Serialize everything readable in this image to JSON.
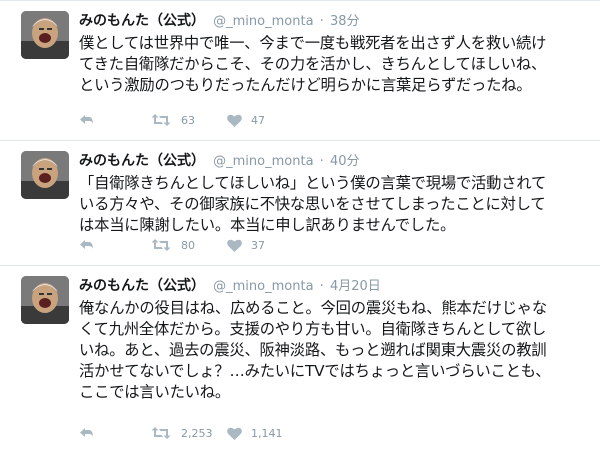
{
  "tweets": [
    {
      "name": "みのもんた（公式）",
      "handle": "@_mino_monta",
      "separator": "·",
      "time": "38分",
      "text": "僕としては世界中で唯一、今まで一度も戦死者を出さず人を救い続け\nてきた自衛隊だからこそ、その力を活かし、きちんとしてほしいね、\nという激励のつもりだったんだけど明らかに言葉足らずだったね。",
      "retweets": "63",
      "likes": "47"
    },
    {
      "name": "みのもんた（公式）",
      "handle": "@_mino_monta",
      "separator": "·",
      "time": "40分",
      "text": "「自衛隊きちんとしてほしいね」という僕の言葉で現場で活動されて\nいる方々や、その御家族に不快な思いをさせてしまったことに対して\nは本当に陳謝したい。本当に申し訳ありませんでした。",
      "retweets": "80",
      "likes": "37"
    },
    {
      "name": "みのもんた（公式）",
      "handle": "@_mino_monta",
      "separator": "·",
      "time": "4月20日",
      "text": "俺なんかの役目はね、広めること。今回の震災もね、熊本だけじゃな\nくて九州全体だから。支援のやり方も甘い。自衛隊きちんとして欲し\nいね。あと、過去の震災、阪神淡路、もっと遡れば関東大震災の教訓\n活かせてないでしょ？…みたいにTVではちょっと言いづらいことも、\nここでは言いたいね。",
      "retweets": "2,253",
      "likes": "1,141"
    }
  ],
  "icons": {
    "reply": "reply-arrow-icon",
    "retweet": "retweet-icon",
    "like": "heart-icon"
  },
  "colors": {
    "name": "#14171a",
    "meta": "#8899a6",
    "divider": "#e1e8ed"
  }
}
